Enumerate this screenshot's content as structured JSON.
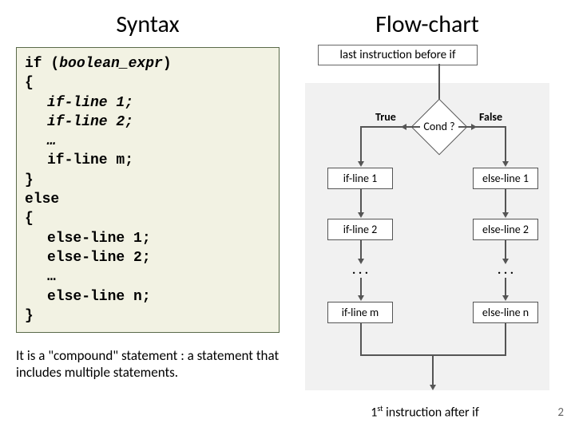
{
  "left": {
    "heading": "Syntax",
    "code": {
      "l1a": "if (",
      "l1b": "boolean_expr",
      "l1c": ")",
      "l2": "{",
      "l3": "if-line 1;",
      "l4": "if-line 2;",
      "l5": "…",
      "l6": "if-line m;",
      "l7": "}",
      "l8": "else",
      "l9": "{",
      "l10": "else-line 1;",
      "l11": "else-line 2;",
      "l12": "…",
      "l13": "else-line n;",
      "l14": "}"
    },
    "note": "It is a \"compound\" statement : a statement that includes multiple statements."
  },
  "right": {
    "heading": "Flow-chart",
    "top_box": "last instruction before if",
    "cond": "Cond ?",
    "true_label": "True",
    "false_label": "False",
    "left_boxes": {
      "b1": "if-line 1",
      "b2": "if-line 2",
      "dots": ". . .",
      "b3": "if-line m"
    },
    "right_boxes": {
      "b1": "else-line 1",
      "b2": "else-line 2",
      "dots": ". . .",
      "b3": "else-line n"
    },
    "bottom_a": "1",
    "bottom_b": "st",
    "bottom_c": " instruction after if"
  },
  "page": "2"
}
